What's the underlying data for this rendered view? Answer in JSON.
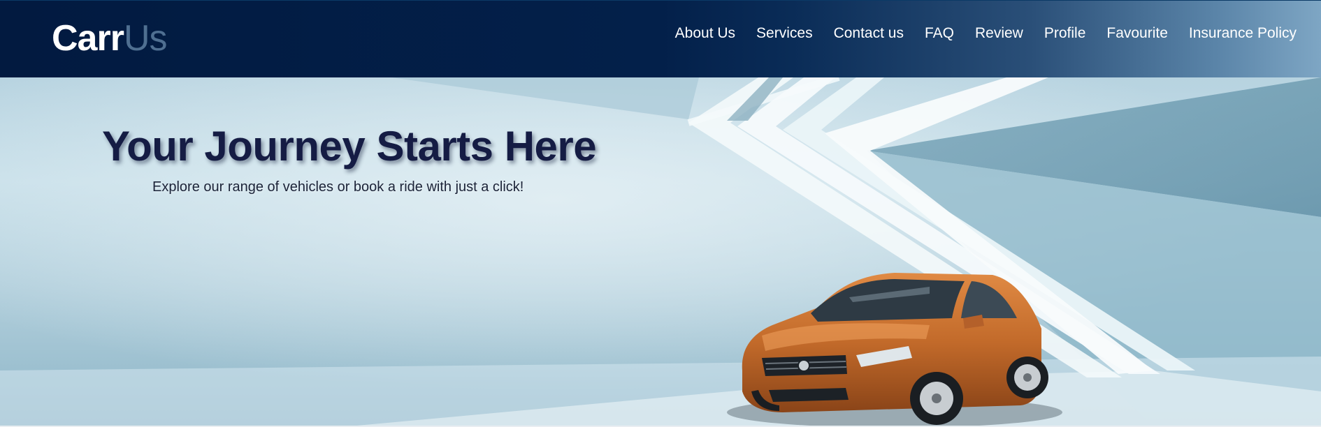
{
  "brand": {
    "name_part1": "Carr",
    "name_part2": "Us"
  },
  "nav": {
    "items": [
      {
        "label": "About Us"
      },
      {
        "label": "Services"
      },
      {
        "label": "Contact us"
      },
      {
        "label": "FAQ"
      },
      {
        "label": "Review"
      },
      {
        "label": "Profile"
      },
      {
        "label": "Favourite"
      },
      {
        "label": "Insurance Policy"
      }
    ]
  },
  "hero": {
    "headline": "Your Journey Starts Here",
    "subheadline": "Explore our range of vehicles or book a ride with just a click!",
    "image": "orange-sedan-car"
  },
  "colors": {
    "nav_bg": "#021a40",
    "headline": "#151c44",
    "logo_accent": "#4f6f91",
    "car": "#c26a2a"
  }
}
